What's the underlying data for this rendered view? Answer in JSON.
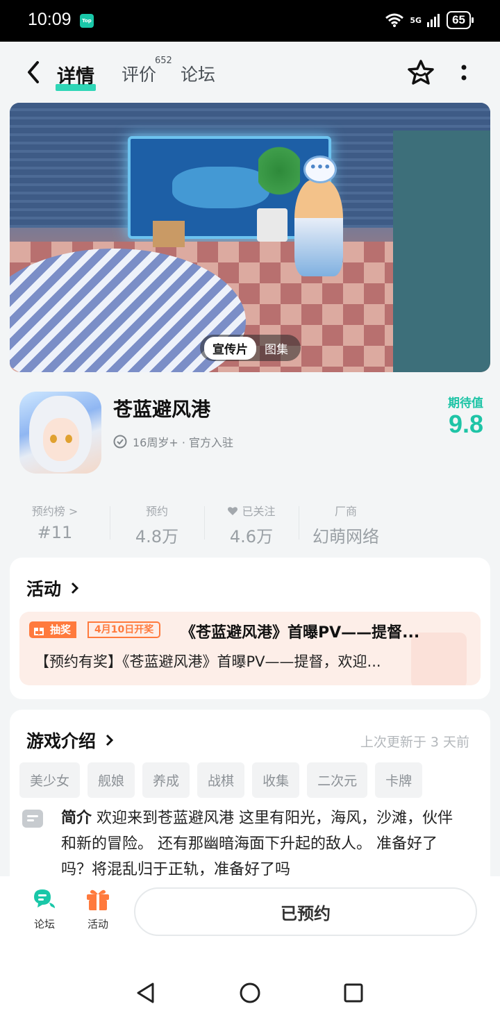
{
  "status_bar": {
    "time": "10:09",
    "app_badge": "Top",
    "network": "5G",
    "battery": "65"
  },
  "nav": {
    "tabs": [
      {
        "label": "详情",
        "active": true
      },
      {
        "label": "评价",
        "count": "652"
      },
      {
        "label": "论坛"
      }
    ],
    "icons": [
      "back-icon",
      "star-icon",
      "more-icon"
    ]
  },
  "banner": {
    "segments": [
      "宣传片",
      "图集"
    ],
    "selected": "宣传片"
  },
  "game": {
    "title": "苍蓝避风港",
    "meta": "16周岁+ · 官方入驻",
    "expect_label": "期待值",
    "expect_value": "9.8"
  },
  "stats": [
    {
      "label": "预约榜 >",
      "value": "#11"
    },
    {
      "label": "预约",
      "value": "4.8万"
    },
    {
      "label": "已关注",
      "value": "4.6万"
    },
    {
      "label": "厂商",
      "value": "幻萌网络"
    }
  ],
  "activity": {
    "title": "活动",
    "badge": "抽奖",
    "date_badge": "4月10日开奖",
    "headline": "《苍蓝避风港》首曝PV——提督...",
    "description": "【预约有奖】《苍蓝避风港》首曝PV——提督，欢迎..."
  },
  "intro": {
    "title": "游戏介绍",
    "updated": "上次更新于 3 天前",
    "tags": [
      "美少女",
      "舰娘",
      "养成",
      "战棋",
      "收集",
      "二次元",
      "卡牌"
    ],
    "label": "简介",
    "text": "欢迎来到苍蓝避风港 这里有阳光，海风，沙滩，伙伴和新的冒险。 还有那幽暗海面下升起的敌人。 准备好了吗？将混乱归于正轨，准备好了吗"
  },
  "bottom_bar": {
    "forum_label": "论坛",
    "activity_label": "活动",
    "reserve_label": "已预约"
  },
  "colors": {
    "accent": "#1ec4a6",
    "orange": "#ff7a3d"
  }
}
